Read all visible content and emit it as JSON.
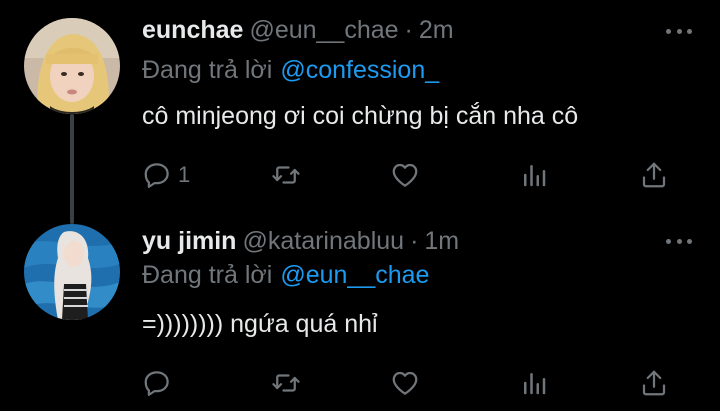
{
  "tweets": [
    {
      "name": "eunchae",
      "handle": "@eun__chae",
      "dot": "·",
      "time": "2m",
      "reply_prefix": "Đang trả lời",
      "reply_to": "@confession_",
      "content": "cô minjeong ơi coi chừng bị cắn nha cô",
      "reply_count": "1"
    },
    {
      "name": "yu jimin",
      "handle": "@katarinabluu",
      "dot": "·",
      "time": "1m",
      "reply_prefix": "Đang trả lời",
      "reply_to": "@eun__chae",
      "content": "=)))))))) ngứa quá nhỉ",
      "reply_count": ""
    }
  ],
  "colors": {
    "background": "#000000",
    "text_primary": "#e7e9ea",
    "text_secondary": "#71767b",
    "accent": "#1d9bf0",
    "thread_line": "#3a3f44"
  },
  "icons": [
    "reply-icon",
    "retweet-icon",
    "like-icon",
    "stats-icon",
    "share-icon",
    "more-icon"
  ]
}
